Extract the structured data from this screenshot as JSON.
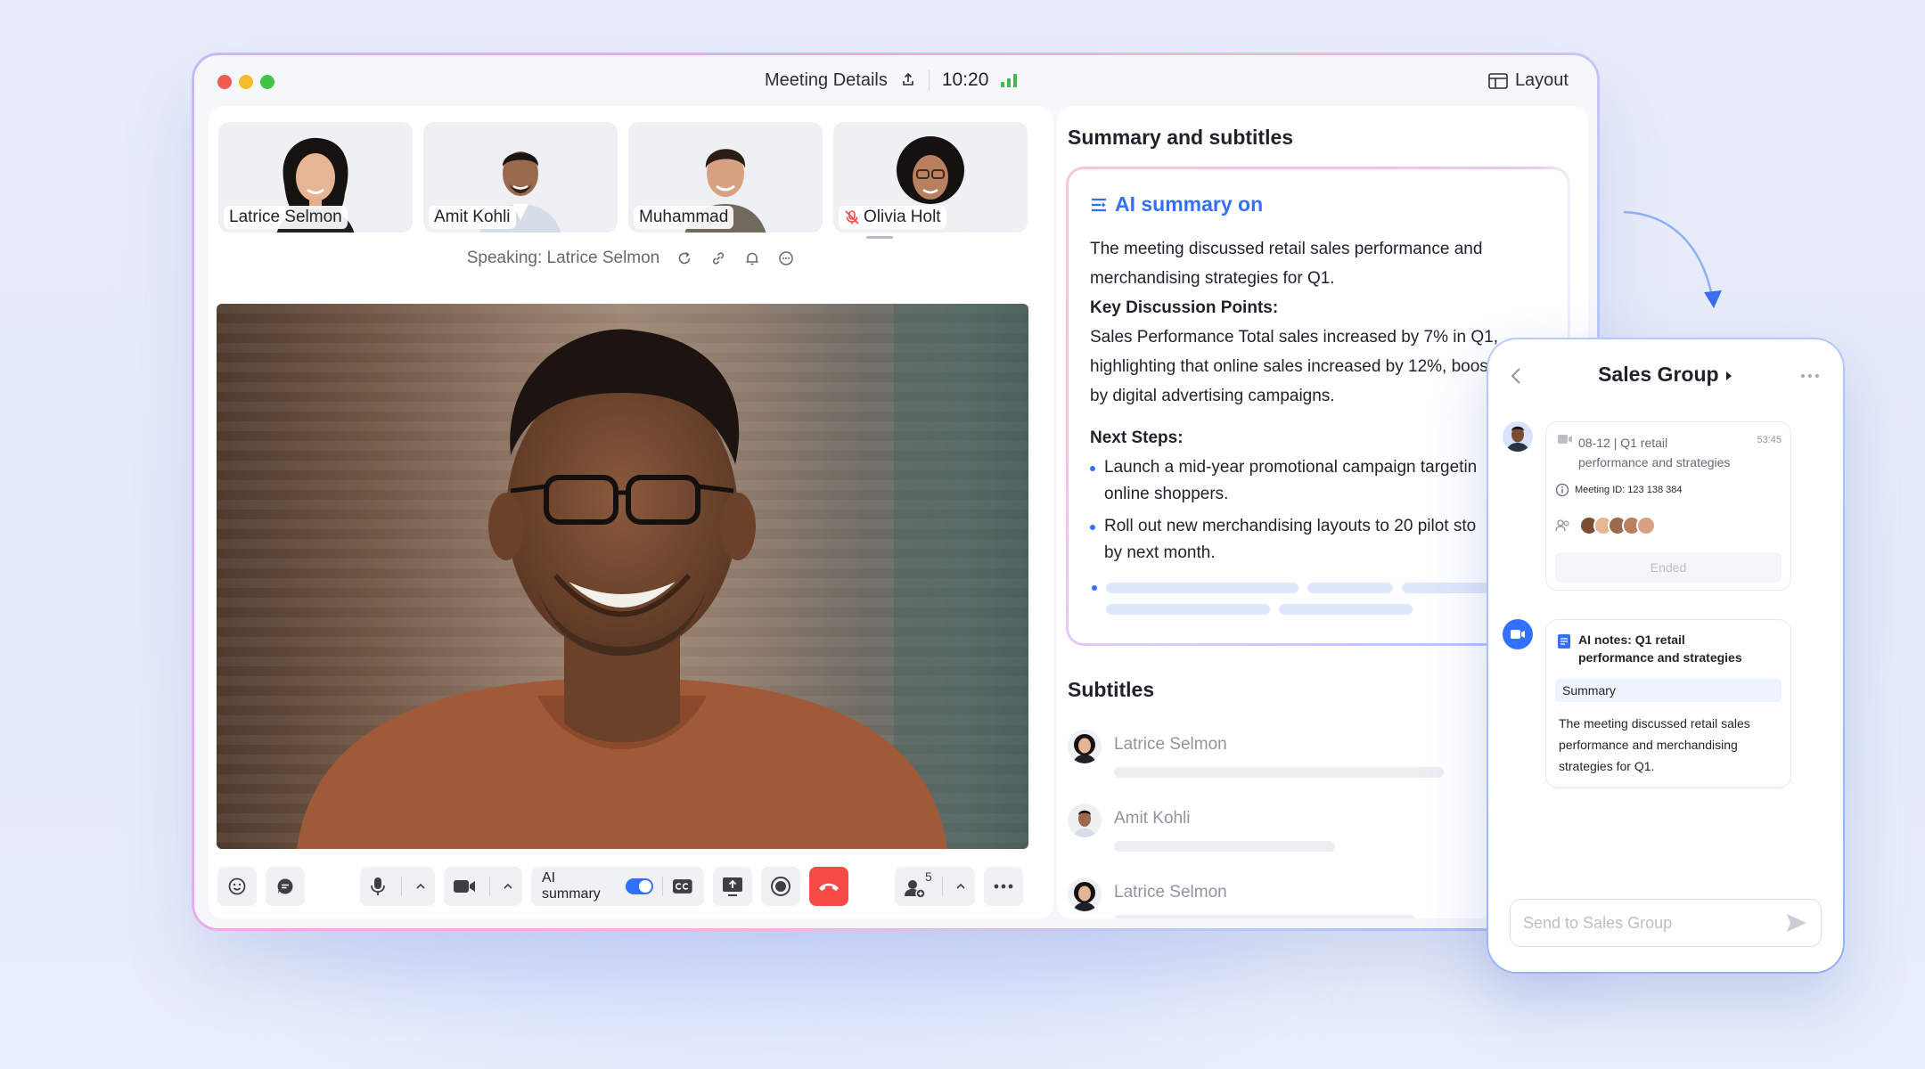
{
  "window": {
    "title": "Meeting Details",
    "time": "10:20",
    "layout_label": "Layout"
  },
  "participants": [
    {
      "name": "Latrice Selmon",
      "muted": false
    },
    {
      "name": "Amit Kohli",
      "muted": false
    },
    {
      "name": "Muhammad",
      "muted": false
    },
    {
      "name": "Olivia Holt",
      "muted": true
    }
  ],
  "speaking_label": "Speaking: Latrice Selmon",
  "toolbar": {
    "ai_summary_label": "AI summary",
    "ai_summary_on": true,
    "participant_count": "5"
  },
  "summary_panel": {
    "title": "Summary and subtitles",
    "ai_header": "AI summary on",
    "intro_line1": "The meeting discussed retail sales performance and",
    "intro_line2": "merchandising strategies for Q1.",
    "key_points_heading": "Key Discussion Points:",
    "kp_line1": "Sales Performance Total sales increased by 7% in Q1,",
    "kp_line2": "highlighting that online sales increased by 12%, boos",
    "kp_line3": "by digital advertising campaigns.",
    "next_steps_heading": "Next Steps:",
    "steps": [
      {
        "line1": "Launch a mid-year promotional campaign targetin",
        "line2": "online shoppers."
      },
      {
        "line1": "Roll out new merchandising layouts to 20 pilot sto",
        "line2": "by next month."
      }
    ]
  },
  "subtitles": {
    "title": "Subtitles",
    "items": [
      {
        "speaker": "Latrice Selmon"
      },
      {
        "speaker": "Amit Kohli"
      },
      {
        "speaker": "Latrice Selmon"
      }
    ]
  },
  "chat": {
    "title": "Sales Group",
    "meeting_card": {
      "title_line1": "08-12 | Q1 retail",
      "title_line2": "performance and strategies",
      "duration": "53:45",
      "meeting_id": "Meeting ID: 123 138 384",
      "status": "Ended"
    },
    "notes_card": {
      "title_line1": "AI notes: Q1 retail",
      "title_line2": "performance and strategies",
      "section": "Summary",
      "body_line1": "The meeting discussed retail sales",
      "body_line2": "performance and merchandising",
      "body_line3": "strategies for Q1."
    },
    "input_placeholder": "Send to Sales Group"
  },
  "colors": {
    "accent": "#3370ff",
    "hangup": "#f54a45",
    "signal": "#3fb950"
  }
}
